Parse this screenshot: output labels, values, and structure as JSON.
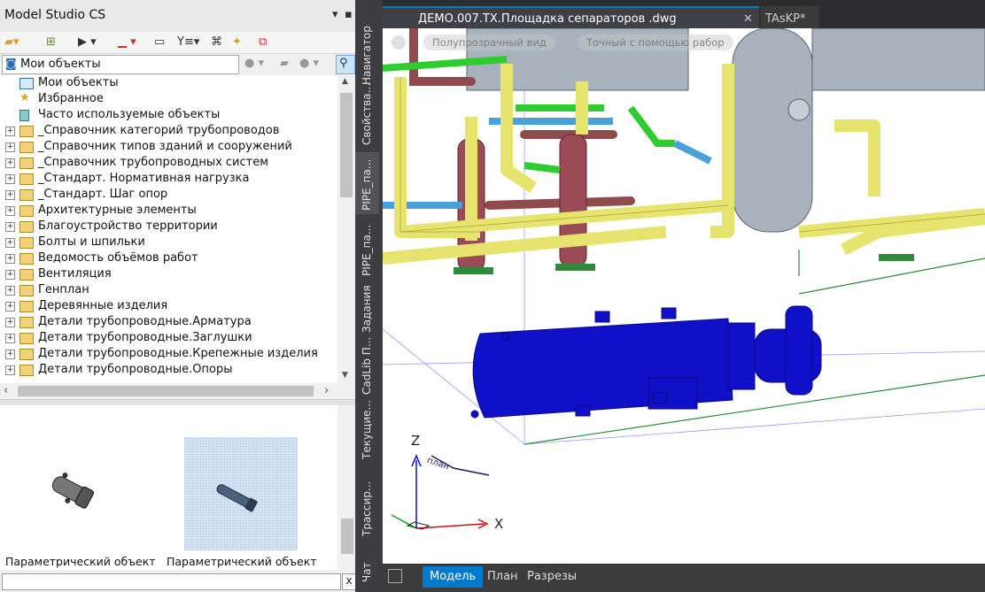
{
  "panel": {
    "title": "Model Studio CS",
    "combo_value": "Мои объекты",
    "tree": [
      {
        "label": "Мои объекты",
        "expandable": false,
        "icon": "my-objects-icon"
      },
      {
        "label": "Избранное",
        "expandable": false,
        "icon": "star-icon"
      },
      {
        "label": "Часто используемые объекты",
        "expandable": false,
        "icon": "book-icon"
      },
      {
        "label": "_Справочник категорий трубопроводов",
        "expandable": true,
        "icon": "folder-icon"
      },
      {
        "label": "_Справочник типов зданий и сооружений",
        "expandable": true,
        "icon": "folder-icon"
      },
      {
        "label": "_Справочник трубопроводных систем",
        "expandable": true,
        "icon": "folder-icon"
      },
      {
        "label": "_Стандарт. Нормативная нагрузка",
        "expandable": true,
        "icon": "folder-icon"
      },
      {
        "label": "_Стандарт. Шаг опор",
        "expandable": true,
        "icon": "folder-icon"
      },
      {
        "label": "Архитектурные элементы",
        "expandable": true,
        "icon": "folder-icon"
      },
      {
        "label": "Благоустройство территории",
        "expandable": true,
        "icon": "folder-icon"
      },
      {
        "label": "Болты и шпильки",
        "expandable": true,
        "icon": "folder-icon"
      },
      {
        "label": "Ведомость объёмов работ",
        "expandable": true,
        "icon": "folder-icon"
      },
      {
        "label": "Вентиляция",
        "expandable": true,
        "icon": "folder-icon"
      },
      {
        "label": "Генплан",
        "expandable": true,
        "icon": "folder-icon"
      },
      {
        "label": "Деревянные изделия",
        "expandable": true,
        "icon": "folder-icon"
      },
      {
        "label": "Детали трубопроводные.Арматура",
        "expandable": true,
        "icon": "folder-icon"
      },
      {
        "label": "Детали трубопроводные.Заглушки",
        "expandable": true,
        "icon": "folder-icon"
      },
      {
        "label": "Детали трубопроводные.Крепежные изделия",
        "expandable": true,
        "icon": "folder-icon"
      },
      {
        "label": "Детали трубопроводные.Опоры",
        "expandable": true,
        "icon": "folder-icon"
      }
    ],
    "previews": [
      {
        "label": "Параметрический объект"
      },
      {
        "label": "Параметрический объект"
      }
    ]
  },
  "side_tabs": [
    "Навигатор",
    "Свойства...",
    "PIPE_па...",
    "PIPE_па...",
    "Задания",
    "CadLib П...",
    "Текущие...",
    "Трассир...",
    "Чат"
  ],
  "doc_tabs": [
    {
      "label": "ДЕМО.007.ТХ.Площадка сепараторов .dwg",
      "active": true
    },
    {
      "label": "TAsKP*",
      "active": false
    }
  ],
  "viewport": {
    "overlay_left": "Полупрозрачный вид",
    "overlay_right": "Точный с помощью рабор",
    "axis_z": "Z",
    "axis_x": "X",
    "ucs_label": "план"
  },
  "layout_tabs": [
    {
      "label": "Модель",
      "active": true
    },
    {
      "label": "План",
      "active": false
    },
    {
      "label": "Разрезы",
      "active": false
    }
  ],
  "search_close": "x",
  "colors": {
    "accent": "#007acc",
    "pipe_yellow": "#f2f08a",
    "pipe_green": "#2ecc2e",
    "vessel": "#1010c8"
  }
}
